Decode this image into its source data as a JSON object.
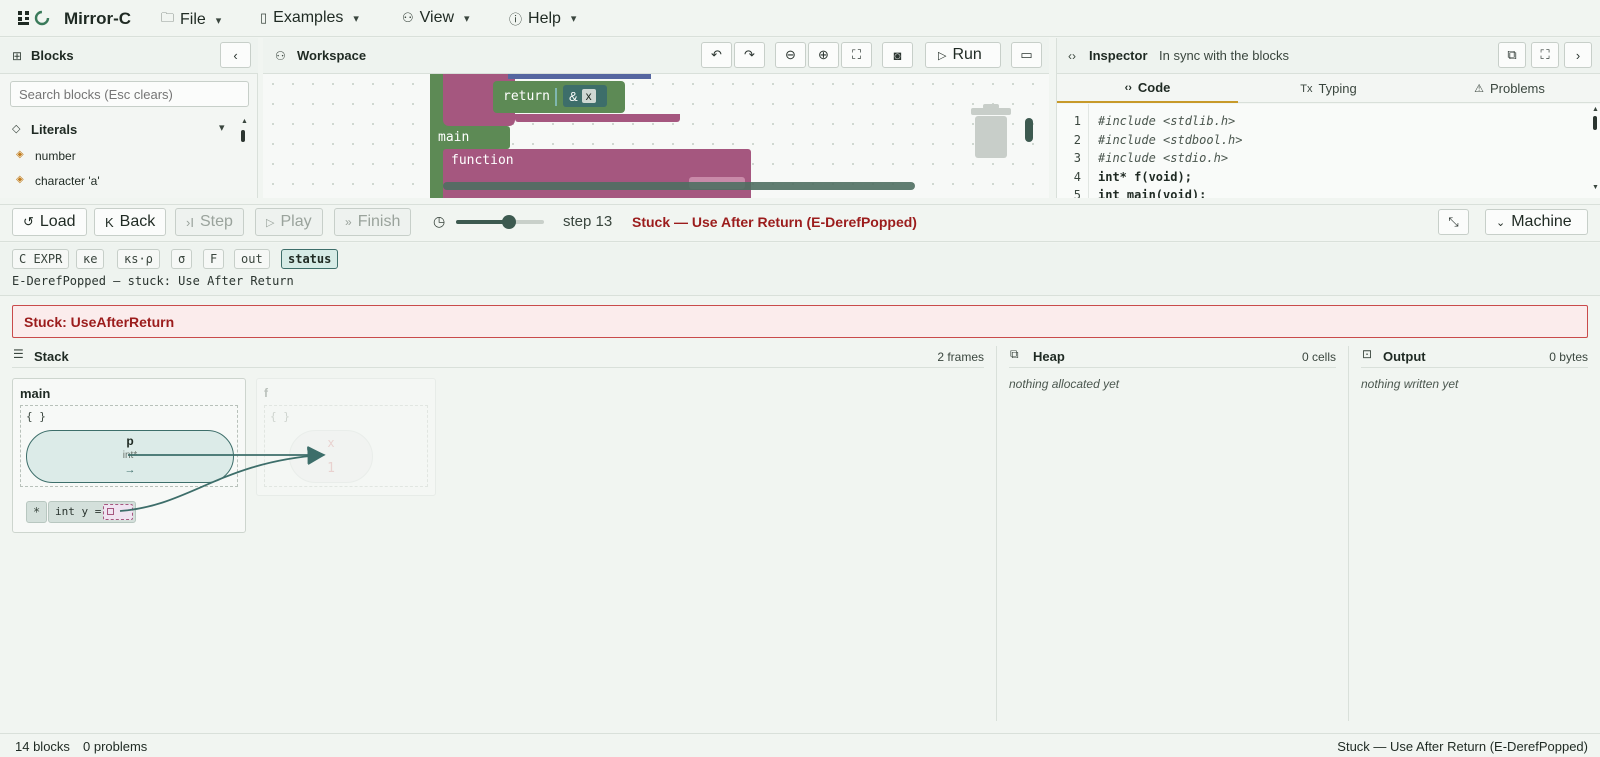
{
  "app": {
    "title": "Mirror-C"
  },
  "menu": [
    {
      "label": "File",
      "icon": "folder-icon"
    },
    {
      "label": "Examples",
      "icon": "book-icon"
    },
    {
      "label": "View",
      "icon": "view-icon"
    },
    {
      "label": "Help",
      "icon": "info-icon"
    }
  ],
  "blocks": {
    "title": "Blocks",
    "search_placeholder": "Search blocks (Esc clears)",
    "category": "Literals",
    "items": [
      "number",
      "character 'a'"
    ]
  },
  "workspace": {
    "title": "Workspace",
    "run_label": "Run",
    "block_return": "return",
    "block_addr": "&",
    "block_var": "x",
    "block_main": "main",
    "block_function": "function"
  },
  "inspector": {
    "title": "Inspector",
    "subtitle": "In sync with the blocks",
    "tabs": [
      "Code",
      "Typing",
      "Problems"
    ],
    "code_lines": [
      {
        "n": "1",
        "text": "#include <stdlib.h>"
      },
      {
        "n": "2",
        "text": "#include <stdbool.h>"
      },
      {
        "n": "3",
        "text": "#include <stdio.h>"
      },
      {
        "n": "4",
        "text": "int* f(void);"
      },
      {
        "n": "5",
        "text": "int main(void);"
      }
    ]
  },
  "controls": {
    "load": "Load",
    "back": "Back",
    "step": "Step",
    "play": "Play",
    "finish": "Finish",
    "step_label": "step 13",
    "status": "Stuck — Use After Return (E-DerefPopped)",
    "machine": "Machine",
    "slider_fraction": 0.62
  },
  "chips": [
    "C EXPR",
    "κe",
    "κs·ρ",
    "σ",
    "F",
    "out",
    "status"
  ],
  "rule_text": "E-DerefPopped — stuck: Use After Return",
  "error_banner": "Stuck: UseAfterReturn",
  "stack": {
    "title": "Stack",
    "count": "2 frames",
    "frames": [
      {
        "name": "main",
        "scope": "{ }",
        "var_name": "p",
        "var_type": "int*",
        "var_value": "→",
        "expr_star": "*",
        "expr_text": "int y ="
      },
      {
        "name": "f",
        "scope": "{ }",
        "var_name": "x",
        "var_value": "1"
      }
    ]
  },
  "heap": {
    "title": "Heap",
    "count": "0 cells",
    "empty": "nothing allocated yet"
  },
  "output": {
    "title": "Output",
    "count": "0 bytes",
    "empty": "nothing written yet"
  },
  "statusbar": {
    "blocks": "14 blocks",
    "problems": "0 problems",
    "right": "Stuck — Use After Return (E-DerefPopped)"
  },
  "colors": {
    "accent": "#3d6e6a",
    "error": "#9b1c1c",
    "block_pink": "#a5577f",
    "block_green": "#5d8a55",
    "tab_underline": "#c79a2a"
  }
}
